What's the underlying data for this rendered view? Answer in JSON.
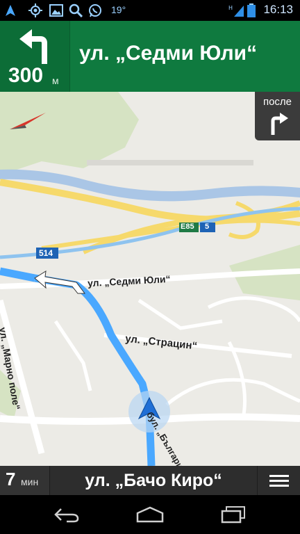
{
  "status_bar": {
    "temperature": "19°",
    "time": "16:13",
    "icons": [
      "navigation-arrow-icon",
      "gps-icon",
      "gallery-icon",
      "search-icon",
      "whatsapp-icon",
      "signal-icon",
      "battery-icon"
    ]
  },
  "navigation": {
    "next_turn": "turn-left",
    "distance": "300",
    "distance_unit": "м",
    "next_street": "ул. „Седми Юли“"
  },
  "then_turn": {
    "label": "после",
    "direction": "turn-right"
  },
  "map": {
    "labels": {
      "road_e85": "E85",
      "road_5": "5",
      "road_514": "514",
      "street_sedmi_yuli": "ул. „Седми Юли“",
      "street_stratsin": "ул. „Страцин“",
      "street_marno_pole": "ул. „Марно поле“",
      "street_bulgaria": "бул. „България“"
    },
    "colors": {
      "background": "#ecebe6",
      "route": "#4aa8ff",
      "highway": "#f6d96b",
      "water": "#a9c5e8",
      "park": "#cfe0b8"
    }
  },
  "bottom_bar": {
    "remaining_time": "7",
    "time_unit": "мин",
    "current_street": "ул. „Бачо Киро“"
  },
  "system_nav": {
    "buttons": [
      "back",
      "home",
      "recent-apps"
    ]
  }
}
